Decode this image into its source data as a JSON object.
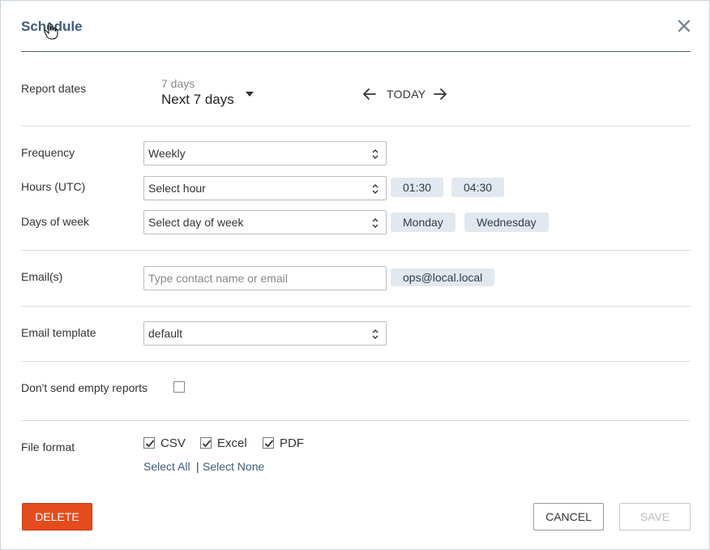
{
  "dialog": {
    "title": "Schedule",
    "close_icon": "close-icon"
  },
  "report_dates": {
    "label": "Report dates",
    "range_small": "7 days",
    "range_value": "Next 7 days",
    "today_label": "TODAY"
  },
  "frequency": {
    "label": "Frequency",
    "value": "Weekly"
  },
  "hours": {
    "label": "Hours (UTC)",
    "placeholder": "Select hour",
    "chips": [
      "01:30",
      "04:30"
    ]
  },
  "days": {
    "label": "Days of week",
    "placeholder": "Select day of week",
    "chips": [
      "Monday",
      "Wednesday"
    ]
  },
  "emails": {
    "label": "Email(s)",
    "placeholder": "Type contact name or email",
    "chips": [
      "ops@local.local"
    ]
  },
  "template": {
    "label": "Email template",
    "value": "default"
  },
  "empty_reports": {
    "label": "Don't send empty reports",
    "checked": false
  },
  "file_format": {
    "label": "File format",
    "options": [
      {
        "label": "CSV",
        "checked": true
      },
      {
        "label": "Excel",
        "checked": true
      },
      {
        "label": "PDF",
        "checked": true
      }
    ],
    "select_all": "Select All",
    "separator": "|",
    "select_none": "Select None"
  },
  "buttons": {
    "delete": "DELETE",
    "cancel": "CANCEL",
    "save": "SAVE"
  },
  "colors": {
    "accent": "#3e5b78",
    "danger": "#e44c1e",
    "chip_bg": "#e1e8ef"
  }
}
